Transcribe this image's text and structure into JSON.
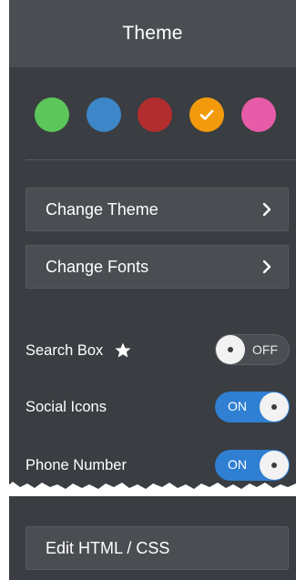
{
  "header": {
    "title": "Theme"
  },
  "swatches": [
    {
      "name": "green",
      "color": "#5cc65a",
      "selected": false
    },
    {
      "name": "blue",
      "color": "#3d86c8",
      "selected": false
    },
    {
      "name": "red",
      "color": "#b22d2d",
      "selected": false
    },
    {
      "name": "orange",
      "color": "#f29a0c",
      "selected": true
    },
    {
      "name": "pink",
      "color": "#e65ca8",
      "selected": false
    }
  ],
  "menu": {
    "change_theme": "Change Theme",
    "change_fonts": "Change Fonts"
  },
  "toggles": {
    "search_box": {
      "label": "Search Box",
      "state": "OFF"
    },
    "social_icons": {
      "label": "Social Icons",
      "state": "ON"
    },
    "phone_number": {
      "label": "Phone Number",
      "state": "ON"
    }
  },
  "footer": {
    "edit_html_css": "Edit HTML / CSS"
  },
  "colors": {
    "panel_bg": "#3a3d41",
    "header_bg": "#4a4d52",
    "toggle_on": "#2f7fd3"
  }
}
